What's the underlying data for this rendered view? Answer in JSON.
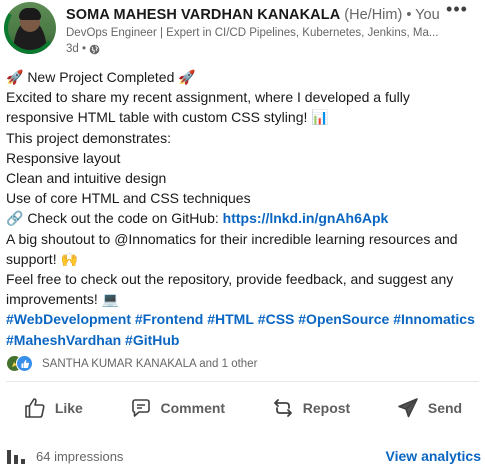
{
  "post": {
    "author": {
      "name": "SOMA MAHESH VARDHAN KANAKALA",
      "pronouns": "(He/Him)",
      "degree": "• You",
      "headline": "DevOps Engineer | Expert in CI/CD Pipelines, Kubernetes, Jenkins, Ma...",
      "time": "3d •",
      "visibility_icon": "globe-icon"
    },
    "more_label": "•••",
    "body": {
      "line1": "🚀 New Project Completed 🚀",
      "line2": "Excited to share my recent assignment, where I developed a fully responsive HTML table with custom CSS styling! 📊",
      "line3": "This project demonstrates:",
      "line4": "Responsive layout",
      "line5": "Clean and intuitive design",
      "line6": "Use of core HTML and CSS techniques",
      "line7_prefix": "🔗 Check out the code on GitHub: ",
      "link": "https://lnkd.in/gnAh6Apk",
      "line8": "A big shoutout to @Innomatics for their incredible learning resources and support! 🙌",
      "line9": "Feel free to check out the repository, provide feedback, and suggest any improvements! 💻",
      "hashtags_row1": [
        "#WebDevelopment",
        "#Frontend",
        "#HTML",
        "#CSS",
        "#OpenSource",
        "#Innomatics"
      ],
      "hashtags_row2": [
        "#MaheshVardhan",
        "#GitHub"
      ]
    },
    "reactions": {
      "icons": [
        "celebrate-icon",
        "like-icon"
      ],
      "label": "SANTHA KUMAR KANAKALA and 1 other"
    },
    "actions": {
      "like": "Like",
      "comment": "Comment",
      "repost": "Repost",
      "send": "Send"
    },
    "footer": {
      "impressions": "64 impressions",
      "analytics": "View analytics"
    }
  },
  "colors": {
    "link": "#0a66c2",
    "text": "#191919",
    "muted": "#666666",
    "like_reaction": "#378fe9",
    "celebrate_reaction": "#44712e"
  }
}
